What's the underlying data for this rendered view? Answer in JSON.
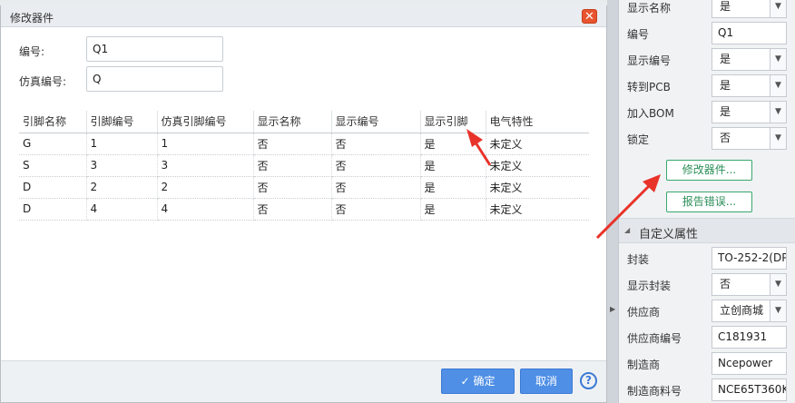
{
  "dialog": {
    "title": "修改器件",
    "designator_label": "编号:",
    "designator_value": "Q1",
    "sim_designator_label": "仿真编号:",
    "sim_designator_value": "Q",
    "table": {
      "headers": [
        "引脚名称",
        "引脚编号",
        "仿真引脚编号",
        "显示名称",
        "显示编号",
        "显示引脚",
        "电气特性"
      ],
      "rows": [
        [
          "G",
          "1",
          "1",
          "否",
          "否",
          "是",
          "未定义"
        ],
        [
          "S",
          "3",
          "3",
          "否",
          "否",
          "是",
          "未定义"
        ],
        [
          "D",
          "2",
          "2",
          "否",
          "否",
          "是",
          "未定义"
        ],
        [
          "D",
          "4",
          "4",
          "否",
          "否",
          "是",
          "未定义"
        ]
      ]
    },
    "ok_label": "确定",
    "cancel_label": "取消",
    "help_glyph": "?"
  },
  "panel": {
    "rows_top": [
      {
        "label": "显示名称",
        "value": "是",
        "type": "select"
      },
      {
        "label": "编号",
        "value": "Q1",
        "type": "text"
      },
      {
        "label": "显示编号",
        "value": "是",
        "type": "select"
      },
      {
        "label": "转到PCB",
        "value": "是",
        "type": "select"
      },
      {
        "label": "加入BOM",
        "value": "是",
        "type": "select"
      },
      {
        "label": "锁定",
        "value": "否",
        "type": "select"
      }
    ],
    "modify_button": "修改器件...",
    "report_button": "报告错误...",
    "section_title": "自定义属性",
    "rows_custom": [
      {
        "label": "封装",
        "value": "TO-252-2(DP",
        "type": "text"
      },
      {
        "label": "显示封装",
        "value": "否",
        "type": "select"
      },
      {
        "label": "供应商",
        "value": "立创商城",
        "type": "select"
      },
      {
        "label": "供应商编号",
        "value": "C181931",
        "type": "text"
      },
      {
        "label": "制造商",
        "value": "Ncepower",
        "type": "text"
      },
      {
        "label": "制造商料号",
        "value": "NCE65T360K",
        "type": "text"
      }
    ]
  },
  "colors": {
    "primary_button": "#4f8fe6",
    "close_button": "#e8542e",
    "green_button": "#3aa76d",
    "annotation_arrow": "#e8332a"
  },
  "icons": {
    "close": "close-icon",
    "check": "check-icon",
    "help": "help-icon",
    "dropdown": "chevron-down-icon",
    "collapse": "triangle-collapse-icon"
  }
}
